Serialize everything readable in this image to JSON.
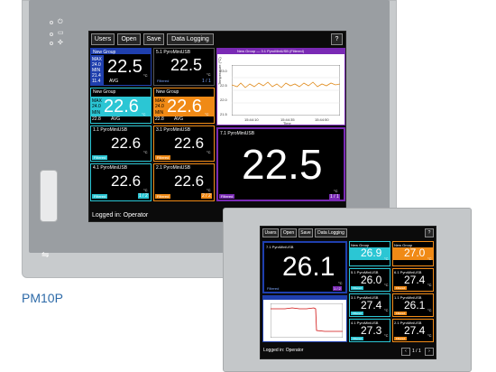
{
  "product_model": "PM10P",
  "big_panel": {
    "toolbar": {
      "users": "Users",
      "open": "Open",
      "save": "Save",
      "data_logging": "Data Logging",
      "help": "?"
    },
    "tiles": {
      "group1": {
        "title": "New Group",
        "max_label": "MAX",
        "max": "24.0",
        "min_label": "MIN",
        "min": "21.4",
        "avg": "11.4",
        "avg_label": "AVG",
        "value": "22.5",
        "unit": "°C"
      },
      "t51": {
        "title": "5.1 PyroMiniUSB",
        "value": "22.5",
        "unit": "°C",
        "tag": "Filtered",
        "page": "1 / 1"
      },
      "group2": {
        "title": "New Group",
        "max_label": "MAX",
        "max": "24.0",
        "min_label": "MIN",
        "min": "22.8",
        "avg_label": "AVG",
        "value": "22.6",
        "unit": "°C"
      },
      "group3": {
        "title": "New Group",
        "max_label": "MAX",
        "max": "24.0",
        "min_label": "MIN",
        "min": "22.8",
        "avg_label": "AVG",
        "value": "22.6",
        "unit": "°C"
      },
      "t11": {
        "title": "1.1 PyroMiniUSB",
        "value": "22.6",
        "unit": "°C",
        "tag": "Filtered"
      },
      "t31": {
        "title": "3.1 PyroMiniUSB",
        "value": "22.6",
        "unit": "°C",
        "tag": "Filtered"
      },
      "t41": {
        "title": "4.1 PyroMiniUSB",
        "value": "22.6",
        "unit": "°C",
        "tag": "Filtered",
        "page": "1 / 2"
      },
      "t21": {
        "title": "2.1 PyroMiniUSB",
        "value": "22.6",
        "unit": "°C",
        "tag": "Filtered",
        "page": "2 / 2"
      },
      "t71": {
        "title": "7.1 PyroMiniUSB",
        "value": "22.5",
        "unit": "°C",
        "tag": "Filtered",
        "page": "1 / 1"
      }
    },
    "trend": {
      "legend": "New Group — 3.1 PyroMiniUSB (Filtered)",
      "ylabel": "Temperature (°C)",
      "xlabel": "Time",
      "yticks": [
        "23.0",
        "22.5",
        "22.0",
        "21.5"
      ],
      "xticks": [
        "15:44:10",
        "15:44:35",
        "15:44:50"
      ]
    },
    "status": "Logged in: Operator"
  },
  "small_panel": {
    "toolbar": {
      "users": "Users",
      "open": "Open",
      "save": "Save",
      "data_logging": "Data Logging",
      "help": "?"
    },
    "big_tile": {
      "title": "7.1 PyroMiniUSB",
      "value": "26.1",
      "unit": "°C",
      "tag": "Filtered",
      "page": "1 / 2"
    },
    "group_a": {
      "title": "New Group",
      "value": "26.9",
      "unit": "°C"
    },
    "group_b": {
      "title": "New Group",
      "value": "27.0",
      "unit": "°C"
    },
    "tiles": [
      {
        "title": "5.1 PyroMiniUSB",
        "value": "26.0",
        "unit": "°C",
        "tag": "Filtered"
      },
      {
        "title": "6.1 PyroMiniUSB",
        "value": "27.4",
        "unit": "°C",
        "tag": "Filtered"
      },
      {
        "title": "3.1 PyroMiniUSB",
        "value": "27.4",
        "unit": "°C",
        "tag": "Filtered"
      },
      {
        "title": "1.1 PyroMiniUSB",
        "value": "26.1",
        "unit": "°C",
        "tag": "Filtered"
      },
      {
        "title": "4.1 PyroMiniUSB",
        "value": "27.3",
        "unit": "°C",
        "tag": "Filtered"
      },
      {
        "title": "2.1 PyroMiniUSB",
        "value": "27.4",
        "unit": "°C",
        "tag": "Filtered"
      }
    ],
    "status": "Logged in: Operator",
    "pager": "1 / 1"
  },
  "colors": {
    "blue": "#1f3fae",
    "cyan": "#2bc6d4",
    "orange": "#f08a16",
    "purple": "#7a2ab5",
    "trace": "#e08a1a",
    "red_trace": "#d01010"
  }
}
